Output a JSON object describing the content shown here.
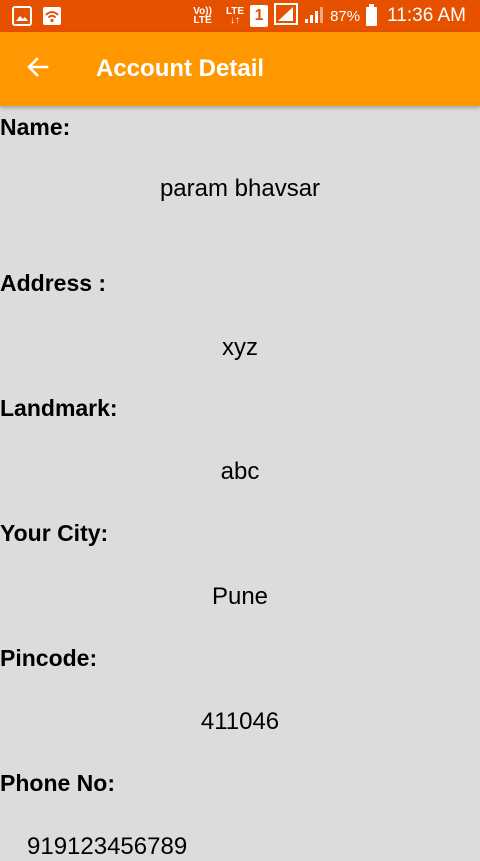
{
  "status_bar": {
    "lte_top": "Vo))",
    "lte_bottom": "LTE",
    "lte2_top": "LTE",
    "lte2_bottom": "↓↑",
    "sim": "1",
    "battery": "87%",
    "time": "11:36 AM"
  },
  "app_bar": {
    "title": "Account Detail"
  },
  "account": {
    "name_label": "Name:",
    "name_value": "param bhavsar",
    "address_label": "Address :",
    "address_value": "xyz",
    "landmark_label": "Landmark:",
    "landmark_value": "abc",
    "city_label": "Your City:",
    "city_value": "Pune",
    "pincode_label": "Pincode:",
    "pincode_value": "411046",
    "phone_label": "Phone No:",
    "phone_value": "919123456789"
  }
}
